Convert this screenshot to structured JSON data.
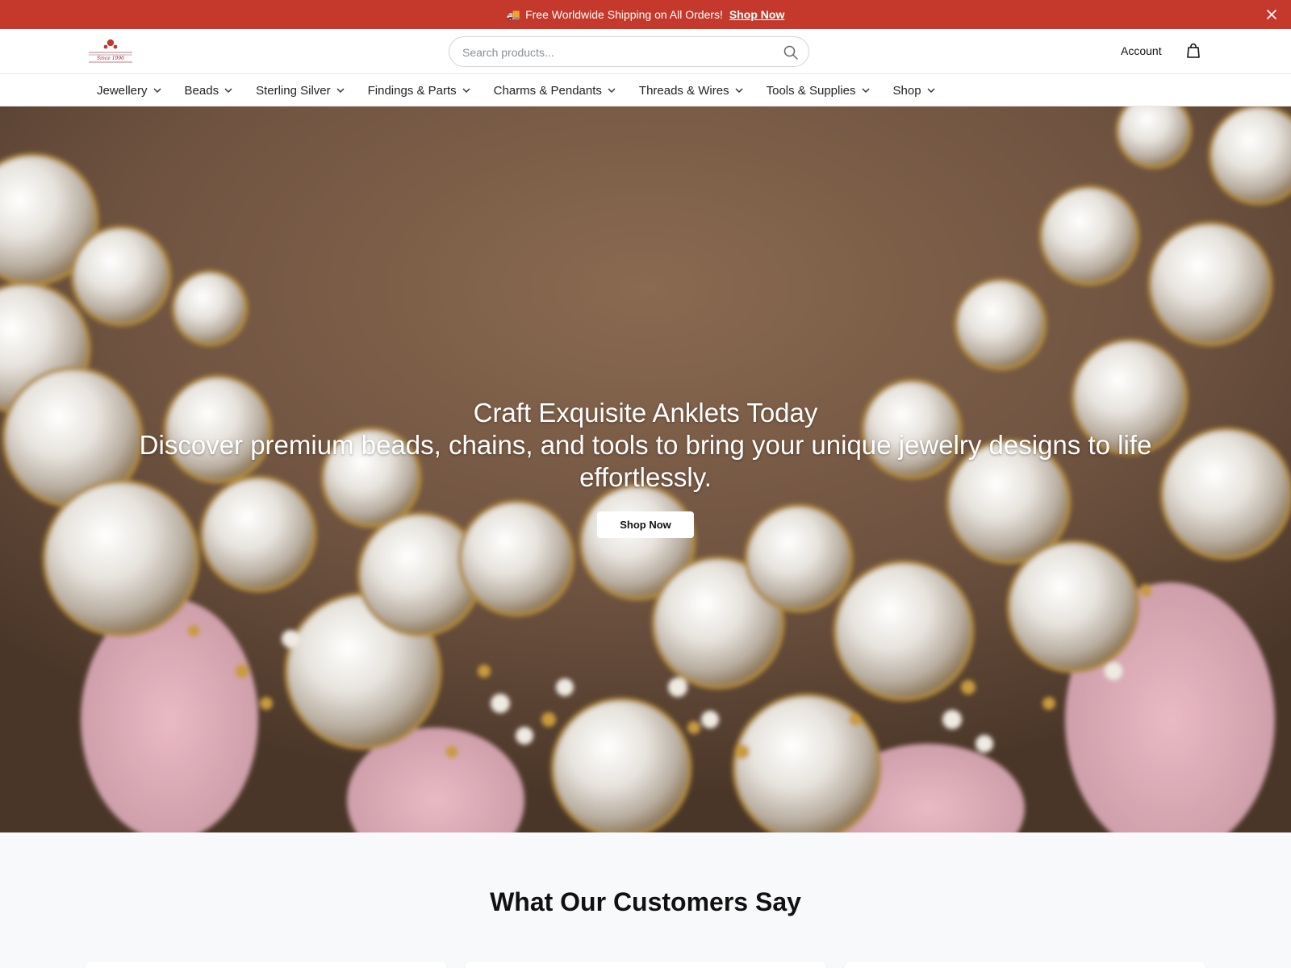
{
  "announcement": {
    "emoji": "🚚",
    "text": "Free Worldwide Shipping on All Orders!",
    "link_label": "Shop Now"
  },
  "header": {
    "logo_text": "Since 1996",
    "search_placeholder": "Search products...",
    "account_label": "Account"
  },
  "nav": {
    "items": [
      {
        "label": "Jewellery"
      },
      {
        "label": "Beads"
      },
      {
        "label": "Sterling Silver"
      },
      {
        "label": "Findings & Parts"
      },
      {
        "label": "Charms & Pendants"
      },
      {
        "label": "Threads & Wires"
      },
      {
        "label": "Tools & Supplies"
      },
      {
        "label": "Shop"
      }
    ]
  },
  "hero": {
    "title": "Craft Exquisite Anklets Today",
    "subtitle": "Discover premium beads, chains, and tools to bring your unique jewelry designs to life effortlessly.",
    "cta_label": "Shop Now"
  },
  "testimonials": {
    "heading": "What Our Customers Say"
  },
  "colors": {
    "announcement_bg": "#c5382c",
    "brand": "#c0392b",
    "hero_skin": "#7a5c44"
  }
}
